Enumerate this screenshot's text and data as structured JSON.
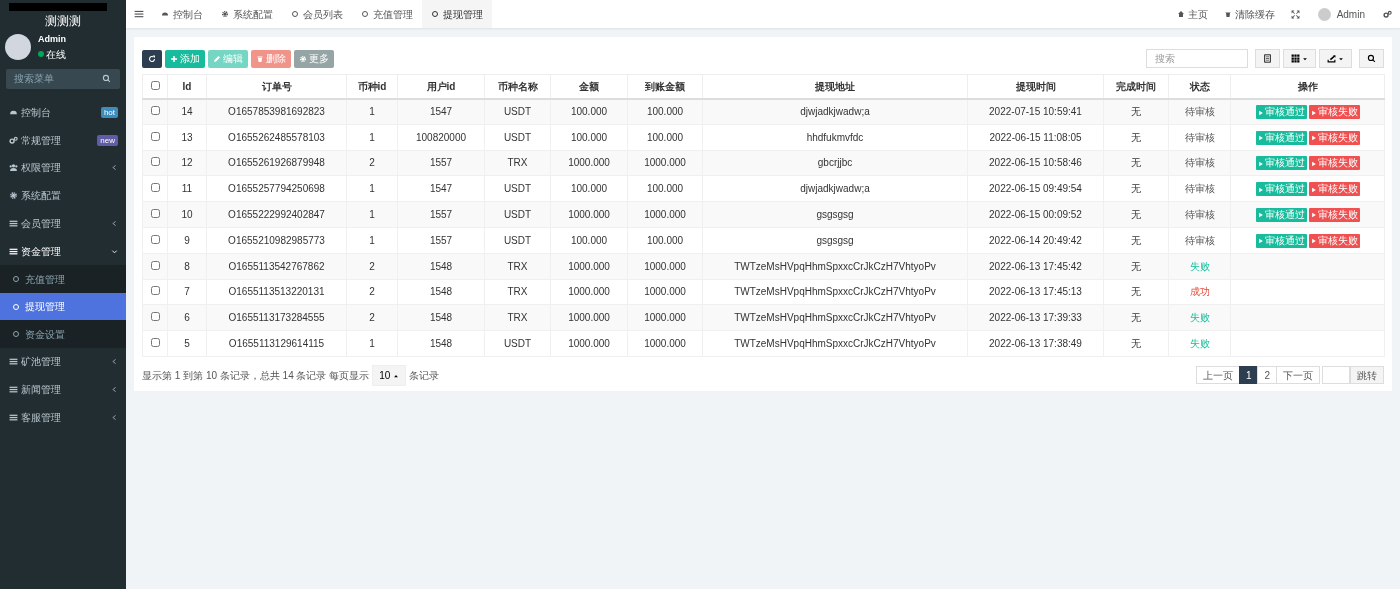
{
  "sidebar": {
    "logo": "测测测",
    "user": {
      "name": "Admin",
      "status": "在线",
      "online": true
    },
    "search": {
      "placeholder": "搜索菜单"
    },
    "items": [
      {
        "label": "控制台",
        "badge": {
          "text": "hot",
          "color": "#3c8dbc"
        }
      },
      {
        "label": "常规管理",
        "badge": {
          "text": "new",
          "color": "#605ca8"
        }
      },
      {
        "label": "权限管理",
        "expanded": false
      },
      {
        "label": "系统配置"
      },
      {
        "label": "会员管理",
        "expanded": false
      },
      {
        "label": "资金管理",
        "expanded": true,
        "children": [
          {
            "label": "充值管理",
            "selected": false
          },
          {
            "label": "提现管理",
            "selected": true
          },
          {
            "label": "资金设置",
            "selected": false
          }
        ]
      },
      {
        "label": "矿池管理",
        "expanded": false
      },
      {
        "label": "新闻管理",
        "expanded": false
      },
      {
        "label": "客服管理",
        "expanded": false
      }
    ]
  },
  "tabs": [
    {
      "label": "控制台",
      "selected": false
    },
    {
      "label": "系统配置",
      "selected": false
    },
    {
      "label": "会员列表",
      "selected": false
    },
    {
      "label": "充值管理",
      "selected": false
    },
    {
      "label": "提现管理",
      "selected": true
    }
  ],
  "topbar_right": [
    {
      "kind": "home",
      "label": "主页"
    },
    {
      "kind": "clear",
      "label": "清除缓存"
    },
    {
      "kind": "fullscreen"
    },
    {
      "kind": "user",
      "label": "Admin"
    },
    {
      "kind": "settings"
    }
  ],
  "toolbar": {
    "buttons": [
      {
        "kind": "refresh",
        "disabled": false
      },
      {
        "kind": "add",
        "label": "添加",
        "disabled": false
      },
      {
        "kind": "edit",
        "label": "编辑",
        "disabled": true
      },
      {
        "kind": "delete",
        "label": "删除",
        "disabled": true
      },
      {
        "kind": "more",
        "label": "更多",
        "disabled": false
      }
    ],
    "search": {
      "placeholder": "搜索"
    }
  },
  "table": {
    "all_checked": false,
    "columns": [
      "Id",
      "订单号",
      "币种id",
      "用户id",
      "币种名称",
      "金额",
      "到账金额",
      "提现地址",
      "提现时间",
      "完成时间",
      "状态",
      "操作"
    ],
    "rows": [
      {
        "checked": false,
        "cells": [
          "14",
          "O1657853981692823",
          "1",
          "1547",
          "USDT",
          "100.000",
          "100.000",
          "djwjadkjwadw;a",
          "2022-07-15 10:59:41",
          "无"
        ],
        "status": {
          "text": "待审核",
          "kind": "pending"
        },
        "actions": [
          {
            "kind": "approve",
            "label": "审核通过"
          },
          {
            "kind": "reject",
            "label": "审核失败"
          }
        ]
      },
      {
        "checked": false,
        "cells": [
          "13",
          "O1655262485578103",
          "1",
          "100820000",
          "USDT",
          "100.000",
          "100.000",
          "hhdfukmvfdc",
          "2022-06-15 11:08:05",
          "无"
        ],
        "status": {
          "text": "待审核",
          "kind": "pending"
        },
        "actions": [
          {
            "kind": "approve",
            "label": "审核通过"
          },
          {
            "kind": "reject",
            "label": "审核失败"
          }
        ]
      },
      {
        "checked": false,
        "cells": [
          "12",
          "O1655261926879948",
          "2",
          "1557",
          "TRX",
          "1000.000",
          "1000.000",
          "gbcrjjbc",
          "2022-06-15 10:58:46",
          "无"
        ],
        "status": {
          "text": "待审核",
          "kind": "pending"
        },
        "actions": [
          {
            "kind": "approve",
            "label": "审核通过"
          },
          {
            "kind": "reject",
            "label": "审核失败"
          }
        ]
      },
      {
        "checked": false,
        "cells": [
          "11",
          "O1655257794250698",
          "1",
          "1547",
          "USDT",
          "100.000",
          "100.000",
          "djwjadkjwadw;a",
          "2022-06-15 09:49:54",
          "无"
        ],
        "status": {
          "text": "待审核",
          "kind": "pending"
        },
        "actions": [
          {
            "kind": "approve",
            "label": "审核通过"
          },
          {
            "kind": "reject",
            "label": "审核失败"
          }
        ]
      },
      {
        "checked": false,
        "cells": [
          "10",
          "O1655222992402847",
          "1",
          "1557",
          "USDT",
          "1000.000",
          "1000.000",
          "gsgsgsg",
          "2022-06-15 00:09:52",
          "无"
        ],
        "status": {
          "text": "待审核",
          "kind": "pending"
        },
        "actions": [
          {
            "kind": "approve",
            "label": "审核通过"
          },
          {
            "kind": "reject",
            "label": "审核失败"
          }
        ]
      },
      {
        "checked": false,
        "cells": [
          "9",
          "O1655210982985773",
          "1",
          "1557",
          "USDT",
          "100.000",
          "100.000",
          "gsgsgsg",
          "2022-06-14 20:49:42",
          "无"
        ],
        "status": {
          "text": "待审核",
          "kind": "pending"
        },
        "actions": [
          {
            "kind": "approve",
            "label": "审核通过"
          },
          {
            "kind": "reject",
            "label": "审核失败"
          }
        ]
      },
      {
        "checked": false,
        "cells": [
          "8",
          "O1655113542767862",
          "2",
          "1548",
          "TRX",
          "1000.000",
          "1000.000",
          "TWTzeMsHVpqHhmSpxxcCrJkCzH7VhtyoPv",
          "2022-06-13 17:45:42",
          "无"
        ],
        "status": {
          "text": "失败",
          "kind": "failed"
        }
      },
      {
        "checked": false,
        "cells": [
          "7",
          "O1655113513220131",
          "2",
          "1548",
          "TRX",
          "1000.000",
          "1000.000",
          "TWTzeMsHVpqHhmSpxxcCrJkCzH7VhtyoPv",
          "2022-06-13 17:45:13",
          "无"
        ],
        "status": {
          "text": "成功",
          "kind": "success"
        }
      },
      {
        "checked": false,
        "cells": [
          "6",
          "O1655113173284555",
          "2",
          "1548",
          "TRX",
          "1000.000",
          "1000.000",
          "TWTzeMsHVpqHhmSpxxcCrJkCzH7VhtyoPv",
          "2022-06-13 17:39:33",
          "无"
        ],
        "status": {
          "text": "失败",
          "kind": "failed"
        }
      },
      {
        "checked": false,
        "cells": [
          "5",
          "O1655113129614115",
          "1",
          "1548",
          "USDT",
          "1000.000",
          "1000.000",
          "TWTzeMsHVpqHhmSpxxcCrJkCzH7VhtyoPv",
          "2022-06-13 17:38:49",
          "无"
        ],
        "status": {
          "text": "失败",
          "kind": "failed"
        }
      }
    ]
  },
  "footer": {
    "summary": "显示第 1 到第 10 条记录，总共 14 条记录 每页显示",
    "page_size": "10",
    "suffix": "条记录"
  },
  "pagination": {
    "prev": "上一页",
    "pages": [
      {
        "label": "1",
        "selected": true
      },
      {
        "label": "2",
        "selected": false
      }
    ],
    "next": "下一页",
    "jump": "跳转"
  }
}
